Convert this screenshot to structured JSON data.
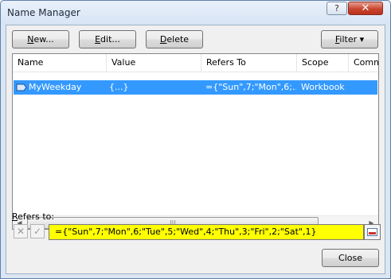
{
  "window": {
    "title": "Name Manager",
    "help_glyph": "?",
    "close_glyph": "✕"
  },
  "toolbar": {
    "new_prefix": "N",
    "new_rest": "ew...",
    "edit_prefix": "E",
    "edit_rest": "dit...",
    "delete_prefix": "D",
    "delete_rest": "elete",
    "filter_prefix": "F",
    "filter_rest": "ilter ▾"
  },
  "list": {
    "columns": [
      "Name",
      "Value",
      "Refers To",
      "Scope",
      "Comme"
    ],
    "rows": [
      {
        "name": "MyWeekday",
        "value": "{...}",
        "refers_to": "={\"Sun\",7;\"Mon\",6;...",
        "scope": "Workbook",
        "comment": ""
      }
    ],
    "scroll_left_glyph": "◀",
    "scroll_right_glyph": "▶",
    "thumb_glyph": "|||"
  },
  "refers_to": {
    "label_prefix": "R",
    "label_rest": "efers to:",
    "cancel_glyph": "✕",
    "confirm_glyph": "✓",
    "formula": "={\"Sun\",7;\"Mon\",6;\"Tue\",5;\"Wed\",4;\"Thu\",3;\"Fri\",2;\"Sat\",1}"
  },
  "footer": {
    "close_label": "Close"
  },
  "icons": {
    "name_icon": "named-range-icon",
    "collapse_icon": "collapse-dialog-icon"
  }
}
